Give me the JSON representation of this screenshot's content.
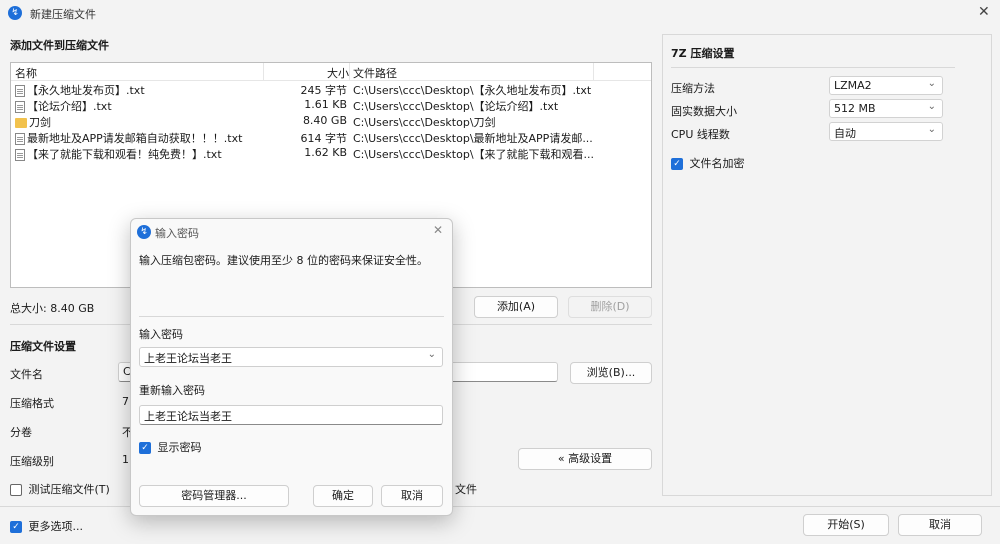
{
  "window": {
    "title": "新建压缩文件",
    "icon": "archive-app-icon"
  },
  "files_section": {
    "title": "添加文件到压缩文件",
    "columns": [
      "名称",
      "大小",
      "文件路径"
    ],
    "rows": [
      {
        "name": "【永久地址发布页】.txt",
        "size": "245 字节",
        "path": "C:\\Users\\ccc\\Desktop\\【永久地址发布页】.txt",
        "icon": "file-icon"
      },
      {
        "name": "【论坛介绍】.txt",
        "size": "1.61 KB",
        "path": "C:\\Users\\ccc\\Desktop\\【论坛介绍】.txt",
        "icon": "file-icon"
      },
      {
        "name": "刀剑",
        "size": "8.40 GB",
        "path": "C:\\Users\\ccc\\Desktop\\刀剑",
        "icon": "folder-icon"
      },
      {
        "name": "最新地址及APP请发邮箱自动获取！！！.txt",
        "size": "614 字节",
        "path": "C:\\Users\\ccc\\Desktop\\最新地址及APP请发邮...",
        "icon": "file-icon"
      },
      {
        "name": "【来了就能下载和观看！纯免费！】.txt",
        "size": "1.62 KB",
        "path": "C:\\Users\\ccc\\Desktop\\【来了就能下载和观看...",
        "icon": "file-icon"
      }
    ],
    "total_label": "总大小: 8.40 GB",
    "add_button": "添加(A)",
    "delete_button": "删除(D)"
  },
  "archive_settings": {
    "title": "压缩文件设置",
    "filename_label": "文件名",
    "filename_value": "C",
    "browse_button": "浏览(B)...",
    "format_label": "压缩格式",
    "format_value": "7",
    "split_label": "分卷",
    "split_value": "不",
    "level_label": "压缩级别",
    "level_value": "1",
    "advanced_button": "« 高级设置",
    "test_checkbox": "测试压缩文件(T)",
    "trailing_text": "文件"
  },
  "bottom": {
    "more_options": "更多选项...",
    "start_button": "开始(S)",
    "cancel_button": "取消"
  },
  "sevenz": {
    "title": "7Z 压缩设置",
    "method_label": "压缩方法",
    "method_value": "LZMA2",
    "dict_label": "固实数据大小",
    "dict_value": "512 MB",
    "threads_label": "CPU 线程数",
    "threads_value": "自动",
    "encrypt_names": "文件名加密"
  },
  "password_dialog": {
    "title": "输入密码",
    "description": "输入压缩包密码。建议使用至少 8 位的密码来保证安全性。",
    "password_label": "输入密码",
    "password_value": "上老王论坛当老王",
    "reenter_label": "重新输入密码",
    "reenter_value": "上老王论坛当老王",
    "show_password": "显示密码",
    "manager_button": "密码管理器...",
    "ok_button": "确定",
    "cancel_button": "取消"
  }
}
